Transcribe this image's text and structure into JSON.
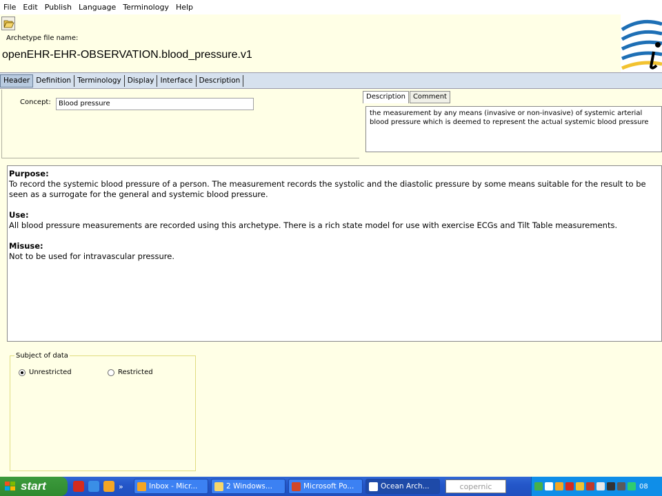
{
  "menu": [
    "File",
    "Edit",
    "Publish",
    "Language",
    "Terminology",
    "Help"
  ],
  "file": {
    "label": "Archetype file name:",
    "value": "openEHR-EHR-OBSERVATION.blood_pressure.v1"
  },
  "tabs": [
    "Header",
    "Definition",
    "Terminology",
    "Display",
    "Interface",
    "Description"
  ],
  "concept": {
    "label": "Concept:",
    "value": "Blood pressure"
  },
  "desc_tabs": [
    "Description",
    "Comment"
  ],
  "description_text": "the measurement by any means (invasive or non-invasive) of systemic arterial blood pressure which is deemed to represent the actual systemic blood pressure",
  "main": {
    "purpose_h": "Purpose:",
    "purpose": "To record the systemic blood pressure of a person. The measurement records the systolic and the diastolic pressure by some means suitable for the result to be seen as a surrogate for the general and systemic blood pressure.",
    "use_h": "Use:",
    "use": "All blood pressure measurements are recorded using this archetype. There is a rich state model for use with exercise ECGs and Tilt Table measurements.",
    "misuse_h": "Misuse:",
    "misuse": "Not to be used for intravascular pressure."
  },
  "subject": {
    "legend": "Subject of data",
    "opt1": "Unrestricted",
    "opt2": "Restricted"
  },
  "taskbar": {
    "start": "start",
    "chevron": "»",
    "tasks": [
      "Inbox - Micr...",
      "2 Windows...",
      "Microsoft Po...",
      "Ocean Arch..."
    ],
    "search": "copernic",
    "clock": "08"
  },
  "colors": {
    "panel": "#ffffe6",
    "tabbar": "#d6e1ee",
    "taskbar": "#2457c9",
    "start": "#2f8a2f"
  }
}
